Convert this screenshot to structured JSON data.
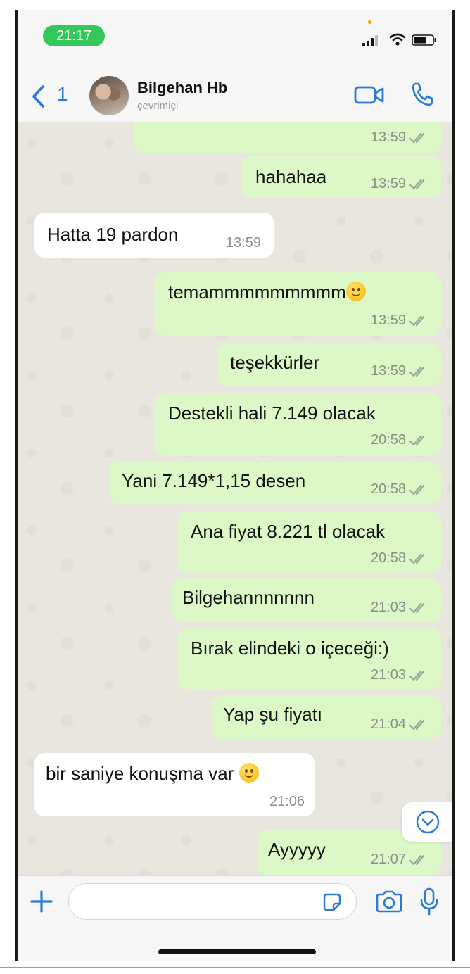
{
  "status_bar": {
    "time": "21:17"
  },
  "header": {
    "back_count": "1",
    "contact_name": "Bilgehan Hb",
    "contact_status": "çevrimiçi"
  },
  "messages": [
    {
      "direction": "out",
      "text": "",
      "time": "13:59",
      "read": true
    },
    {
      "direction": "out",
      "text": "hahahaa",
      "time": "13:59",
      "read": true
    },
    {
      "direction": "in",
      "text": "Hatta 19 pardon",
      "time": "13:59"
    },
    {
      "direction": "out",
      "text": "temammmmmmmmm",
      "emoji": "slightly-smiling-face",
      "time": "13:59",
      "read": true
    },
    {
      "direction": "out",
      "text": "teşekkürler",
      "time": "13:59",
      "read": true
    },
    {
      "direction": "out",
      "text": "Destekli hali 7.149 olacak",
      "time": "20:58",
      "read": true
    },
    {
      "direction": "out",
      "text": "Yani 7.149*1,15 desen",
      "time": "20:58",
      "read": true
    },
    {
      "direction": "out",
      "text": "Ana fiyat 8.221 tl olacak",
      "time": "20:58",
      "read": true
    },
    {
      "direction": "out",
      "text": "Bilgehannnnnnn",
      "time": "21:03",
      "read": true
    },
    {
      "direction": "out",
      "text": "Bırak elindeki o içeceği:)",
      "time": "21:03",
      "read": true
    },
    {
      "direction": "out",
      "text": "Yap şu fiyatı",
      "time": "21:04",
      "read": true
    },
    {
      "direction": "in",
      "text": "bir saniye konuşma var",
      "emoji": "grinning-face",
      "time": "21:06"
    },
    {
      "direction": "out",
      "text": "Ayyyyy",
      "time": "21:07",
      "read": true
    }
  ],
  "input_bar": {
    "placeholder": ""
  },
  "colors": {
    "outgoing_bubble": "#dcf8c6",
    "incoming_bubble": "#ffffff",
    "accent_blue": "#2a7ad8",
    "time_pill": "#34c759"
  },
  "icons": [
    "back-chevron-icon",
    "video-call-icon",
    "phone-call-icon",
    "chevron-down-icon",
    "plus-icon",
    "sticker-icon",
    "camera-icon",
    "mic-icon",
    "double-check-icon"
  ]
}
